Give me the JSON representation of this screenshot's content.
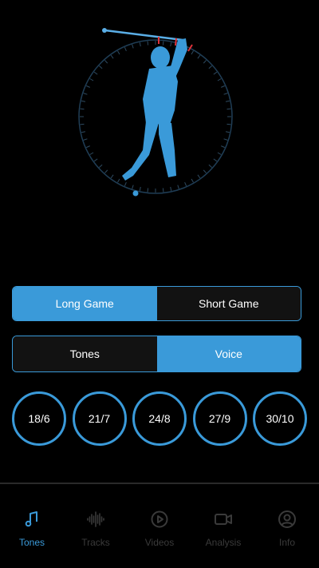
{
  "colors": {
    "accent": "#3a9ad9",
    "background": "#000000",
    "inactive_tab": "#3a3a3a",
    "marker": "#e0323a"
  },
  "graphic": {
    "icon": "golfer-swing-silhouette"
  },
  "game_toggle": {
    "long_label": "Long Game",
    "short_label": "Short Game",
    "selected": "Long Game"
  },
  "mode_toggle": {
    "tones_label": "Tones",
    "voice_label": "Voice",
    "selected": "Voice"
  },
  "tempos": [
    {
      "label": "18/6"
    },
    {
      "label": "21/7"
    },
    {
      "label": "24/8"
    },
    {
      "label": "27/9"
    },
    {
      "label": "30/10"
    }
  ],
  "tabs": [
    {
      "label": "Tones",
      "icon": "music-note-icon",
      "active": true
    },
    {
      "label": "Tracks",
      "icon": "waveform-icon",
      "active": false
    },
    {
      "label": "Videos",
      "icon": "play-circle-icon",
      "active": false
    },
    {
      "label": "Analysis",
      "icon": "video-camera-icon",
      "active": false
    },
    {
      "label": "Info",
      "icon": "user-circle-icon",
      "active": false
    }
  ]
}
